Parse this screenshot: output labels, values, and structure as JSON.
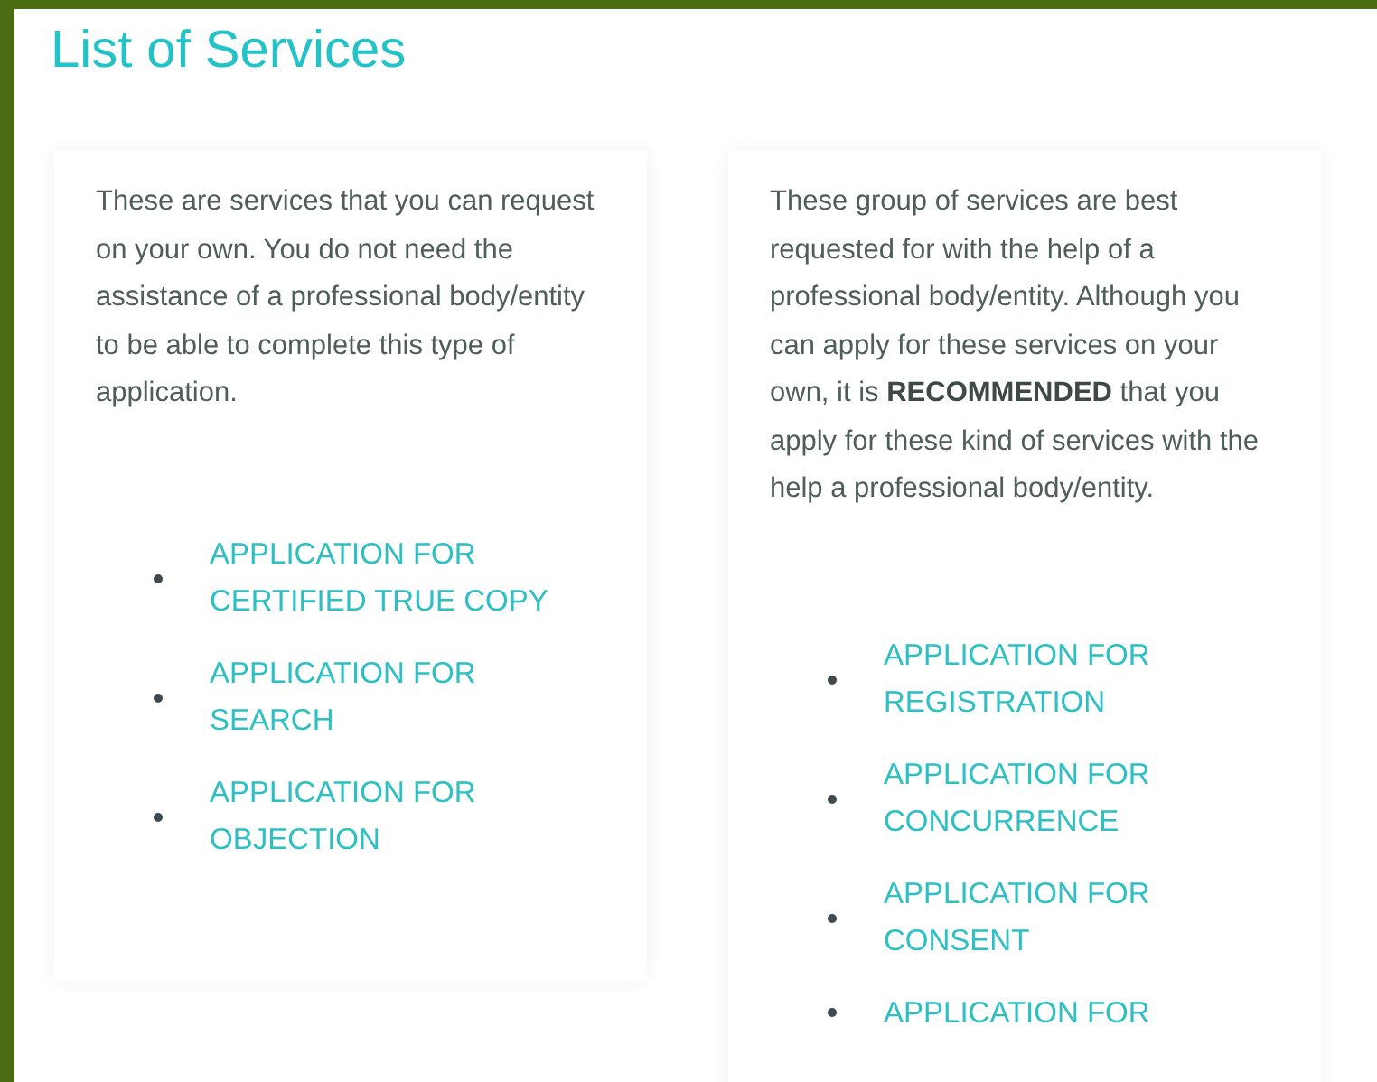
{
  "title": "List of Services",
  "cards": [
    {
      "description": "These are services that you can request on your own. You do not need the assistance of a professional body/entity to be able to complete this type of application.",
      "links": [
        "APPLICATION FOR CERTIFIED TRUE COPY",
        "APPLICATION FOR SEARCH",
        "APPLICATION FOR OBJECTION"
      ]
    },
    {
      "description": "These group of services are best requested for with the help of a professional body/entity. Although you can apply for these services on your own, it is **RECOMMENDED** that you apply for these kind of services with the help a professional body/entity.",
      "links": [
        "APPLICATION FOR REGISTRATION",
        "APPLICATION FOR CONCURRENCE",
        "APPLICATION FOR CONSENT",
        "APPLICATION FOR"
      ]
    }
  ]
}
